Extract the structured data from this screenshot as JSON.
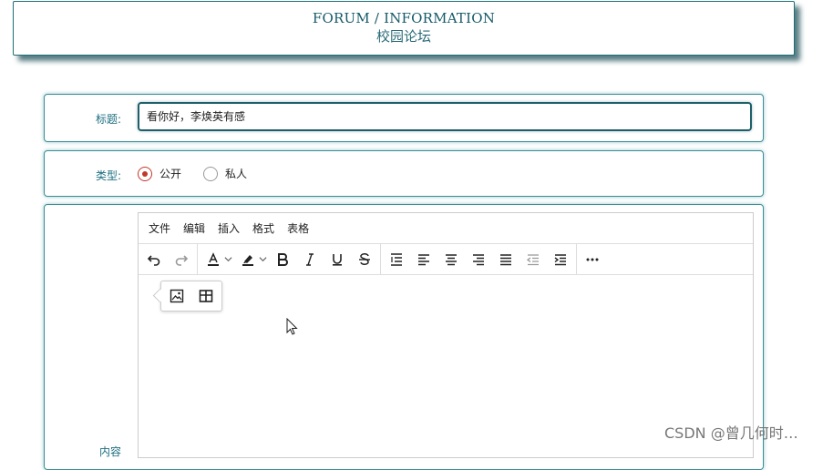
{
  "header": {
    "title_en": "FORUM / INFORMATION",
    "title_cn": "校园论坛"
  },
  "form": {
    "title_label": "标题:",
    "title_value": "看你好，李焕英有感",
    "type_label": "类型:",
    "type_options": [
      {
        "label": "公开",
        "selected": true
      },
      {
        "label": "私人",
        "selected": false
      }
    ],
    "content_label": "内容"
  },
  "editor": {
    "menu": [
      "文件",
      "编辑",
      "插入",
      "格式",
      "表格"
    ],
    "toolbar_icons": [
      "undo-icon",
      "redo-icon",
      "text-color-icon",
      "highlight-icon",
      "bold-icon",
      "italic-icon",
      "underline-icon",
      "strikethrough-icon",
      "line-height-icon",
      "align-left-icon",
      "align-center-icon",
      "align-right-icon",
      "align-justify-icon",
      "outdent-icon",
      "indent-icon",
      "more-icon"
    ],
    "quick_insert_icons": [
      "image-icon",
      "table-icon"
    ]
  },
  "watermark": "CSDN @曾几何时…",
  "colors": {
    "accent": "#1f6f78",
    "radio_selected": "#c0392b"
  }
}
